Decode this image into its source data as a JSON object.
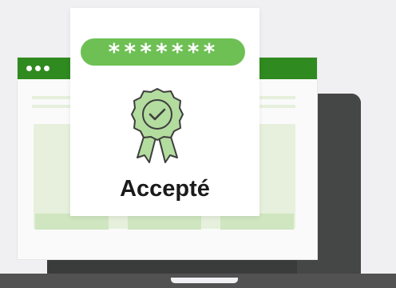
{
  "card": {
    "password_mask": "*******",
    "status_label": "Accepté"
  },
  "icons": {
    "badge": "award-ribbon-checkmark-icon"
  },
  "colors": {
    "accent_green": "#6ec054",
    "titlebar_green": "#2f8a1f",
    "laptop_dark": "#3a3b3b",
    "background": "#f0f0f2"
  }
}
